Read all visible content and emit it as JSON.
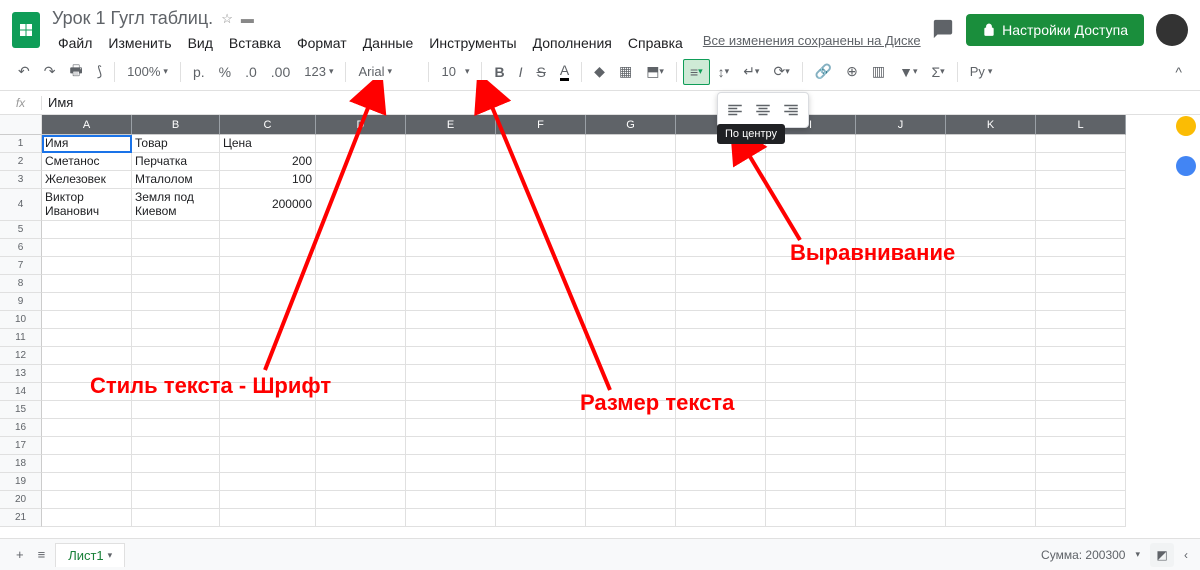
{
  "header": {
    "doc_title": "Урок 1 Гугл таблиц.",
    "saved_text": "Все изменения сохранены на Диске",
    "share_label": "Настройки Доступа",
    "menus": [
      "Файл",
      "Изменить",
      "Вид",
      "Вставка",
      "Формат",
      "Данные",
      "Инструменты",
      "Дополнения",
      "Справка"
    ]
  },
  "toolbar": {
    "zoom": "100%",
    "currency": "р.",
    "percent": "%",
    "dec_less": ".0",
    "dec_more": ".00",
    "more_fmt": "123",
    "font": "Arial",
    "size": "10",
    "spellcheck": "Py"
  },
  "align_popup": {
    "tooltip": "По центру"
  },
  "formula": {
    "fx": "fx",
    "value": "Имя"
  },
  "columns": [
    "A",
    "B",
    "C",
    "D",
    "E",
    "F",
    "G",
    "H",
    "I",
    "J",
    "K",
    "L"
  ],
  "rows": [
    "1",
    "2",
    "3",
    "4",
    "5",
    "6",
    "7",
    "8",
    "9",
    "10",
    "11",
    "12",
    "13",
    "14",
    "15",
    "16",
    "17",
    "18",
    "19",
    "20",
    "21"
  ],
  "cells": {
    "r1": {
      "a": "Имя",
      "b": "Товар",
      "c": "Цена"
    },
    "r2": {
      "a": "Сметанос",
      "b": "Перчатка",
      "c": "200"
    },
    "r3": {
      "a": "Железовек",
      "b": "Мталолом",
      "c": "100"
    },
    "r4": {
      "a": "Виктор\nИванович",
      "b": "Земля под\nКиевом",
      "c": "200000"
    }
  },
  "sheets": {
    "tab1": "Лист1"
  },
  "status": {
    "sum": "Сумма: 200300"
  },
  "annotations": {
    "font_style": "Стиль текста - Шрифт",
    "text_size": "Размер текста",
    "alignment": "Выравнивание"
  }
}
